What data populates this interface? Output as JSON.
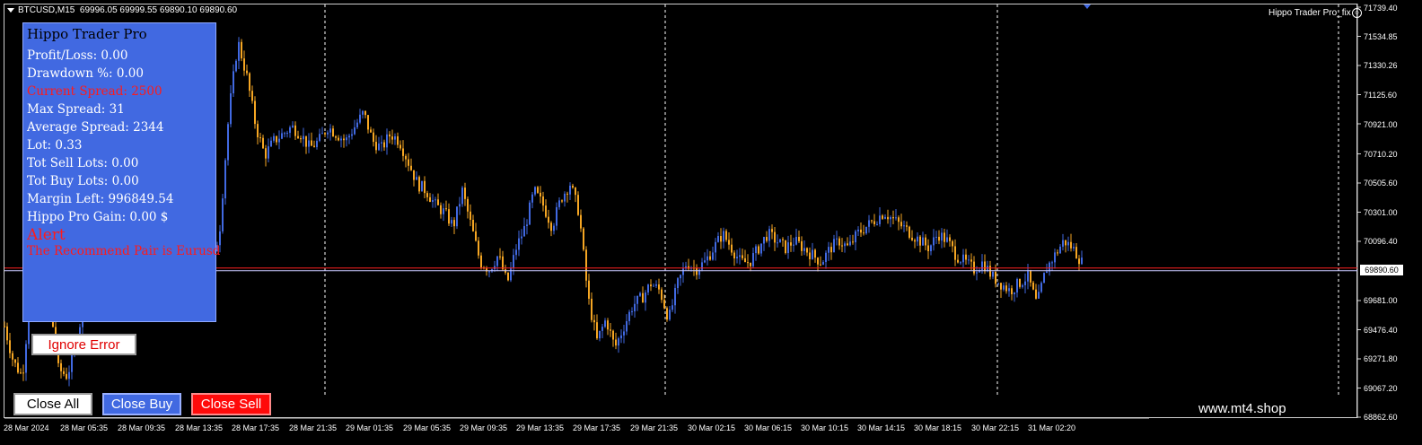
{
  "window": {
    "symbol": "BTCUSD,M15",
    "ohlc": "69996.05 69999.55 69890.10 69890.60",
    "ea_label": "Hippo Trader Pro_fix",
    "smile_icon": "smiley-icon",
    "watermark": "www.mt4.shop"
  },
  "panel": {
    "title": "Hippo Trader Pro",
    "rows": [
      {
        "text": "Profit/Loss: 0.00",
        "color": "#ffffff"
      },
      {
        "text": "Drawdown %: 0.00",
        "color": "#ffffff"
      },
      {
        "text": "Current Spread: 2500",
        "color": "#ff1a1a"
      },
      {
        "text": "Max Spread: 31",
        "color": "#ffffff"
      },
      {
        "text": "Average Spread: 2344",
        "color": "#ffffff"
      },
      {
        "text": "Lot: 0.33",
        "color": "#ffffff"
      },
      {
        "text": "Tot Sell Lots: 0.00",
        "color": "#ffffff"
      },
      {
        "text": "Tot Buy Lots: 0.00",
        "color": "#ffffff"
      },
      {
        "text": "Margin Left: 996849.54",
        "color": "#ffffff"
      },
      {
        "text": "Hippo Pro Gain: 0.00 $",
        "color": "#ffffff"
      }
    ],
    "alert_title": "Alert",
    "alert_message": "The Recommend Pair is Eurusd",
    "bg_color": "#4169e1"
  },
  "buttons": {
    "ignore_error": "Ignore Error",
    "close_all": "Close All",
    "close_buy": "Close Buy",
    "close_sell": "Close Sell"
  },
  "price_axis": {
    "labels": [
      "71739.40",
      "71534.85",
      "71330.26",
      "71125.60",
      "70921.00",
      "70710.20",
      "70505.60",
      "70301.00",
      "70096.40",
      "69681.00",
      "69476.40",
      "69271.80",
      "69067.20",
      "68862.60"
    ],
    "current_price": "69890.60"
  },
  "time_axis": {
    "labels": [
      "28 Mar 2024",
      "28 Mar 05:35",
      "28 Mar 09:35",
      "28 Mar 13:35",
      "28 Mar 17:35",
      "28 Mar 21:35",
      "29 Mar 01:35",
      "29 Mar 05:35",
      "29 Mar 09:35",
      "29 Mar 13:35",
      "29 Mar 17:35",
      "29 Mar 21:35",
      "30 Mar 02:15",
      "30 Mar 06:15",
      "30 Mar 10:15",
      "30 Mar 14:15",
      "30 Mar 18:15",
      "30 Mar 22:15",
      "31 Mar 02:20"
    ]
  },
  "chart_data": {
    "type": "candlestick",
    "symbol": "BTCUSD",
    "timeframe": "M15",
    "ylim": [
      68862.6,
      71739.4
    ],
    "current_price": 69890.6,
    "bull_color": "#4169e1",
    "bear_color": "#f5a623",
    "close_path": [
      [
        0,
        69500
      ],
      [
        10,
        69250
      ],
      [
        20,
        69150
      ],
      [
        30,
        69800
      ],
      [
        40,
        70400
      ],
      [
        50,
        69700
      ],
      [
        60,
        69200
      ],
      [
        70,
        69150
      ],
      [
        80,
        69400
      ],
      [
        90,
        69700
      ],
      [
        100,
        69800
      ],
      [
        110,
        70300
      ],
      [
        120,
        70600
      ],
      [
        130,
        70850
      ],
      [
        140,
        70900
      ],
      [
        150,
        70800
      ],
      [
        160,
        70900
      ],
      [
        170,
        70600
      ],
      [
        180,
        70650
      ],
      [
        190,
        70700
      ],
      [
        200,
        70400
      ],
      [
        210,
        69900
      ],
      [
        220,
        69700
      ],
      [
        230,
        69850
      ],
      [
        240,
        70200
      ],
      [
        250,
        71000
      ],
      [
        260,
        71500
      ],
      [
        270,
        71250
      ],
      [
        280,
        70900
      ],
      [
        290,
        70700
      ],
      [
        300,
        70800
      ],
      [
        310,
        70850
      ],
      [
        320,
        70900
      ],
      [
        330,
        70850
      ],
      [
        340,
        70750
      ],
      [
        350,
        70800
      ],
      [
        360,
        70900
      ],
      [
        370,
        70850
      ],
      [
        380,
        70800
      ],
      [
        390,
        70900
      ],
      [
        400,
        71000
      ],
      [
        410,
        70800
      ],
      [
        420,
        70750
      ],
      [
        430,
        70850
      ],
      [
        440,
        70800
      ],
      [
        450,
        70650
      ],
      [
        460,
        70500
      ],
      [
        470,
        70450
      ],
      [
        480,
        70350
      ],
      [
        490,
        70300
      ],
      [
        500,
        70200
      ],
      [
        510,
        70450
      ],
      [
        520,
        70200
      ],
      [
        530,
        69950
      ],
      [
        540,
        69900
      ],
      [
        550,
        70000
      ],
      [
        560,
        69800
      ],
      [
        570,
        70050
      ],
      [
        580,
        70200
      ],
      [
        590,
        70450
      ],
      [
        600,
        70350
      ],
      [
        610,
        70200
      ],
      [
        620,
        70400
      ],
      [
        630,
        70500
      ],
      [
        640,
        70300
      ],
      [
        650,
        69700
      ],
      [
        660,
        69400
      ],
      [
        670,
        69550
      ],
      [
        680,
        69350
      ],
      [
        690,
        69500
      ],
      [
        700,
        69650
      ],
      [
        710,
        69700
      ],
      [
        720,
        69800
      ],
      [
        730,
        69750
      ],
      [
        740,
        69550
      ],
      [
        750,
        69800
      ],
      [
        760,
        69950
      ],
      [
        770,
        69900
      ],
      [
        780,
        69950
      ],
      [
        790,
        70050
      ],
      [
        800,
        70150
      ],
      [
        810,
        70050
      ],
      [
        820,
        69950
      ],
      [
        830,
        69950
      ],
      [
        840,
        70050
      ],
      [
        850,
        70150
      ],
      [
        860,
        70100
      ],
      [
        870,
        70050
      ],
      [
        880,
        70100
      ],
      [
        890,
        70050
      ],
      [
        900,
        70000
      ],
      [
        910,
        69950
      ],
      [
        920,
        70050
      ],
      [
        930,
        70100
      ],
      [
        940,
        70050
      ],
      [
        950,
        70150
      ],
      [
        960,
        70200
      ],
      [
        970,
        70250
      ],
      [
        980,
        70300
      ],
      [
        990,
        70250
      ],
      [
        1000,
        70200
      ],
      [
        1010,
        70150
      ],
      [
        1020,
        70100
      ],
      [
        1030,
        70050
      ],
      [
        1040,
        70150
      ],
      [
        1050,
        70100
      ],
      [
        1060,
        70000
      ],
      [
        1070,
        69950
      ],
      [
        1080,
        69900
      ],
      [
        1090,
        69950
      ],
      [
        1100,
        69850
      ],
      [
        1110,
        69800
      ],
      [
        1120,
        69750
      ],
      [
        1130,
        69800
      ],
      [
        1140,
        69850
      ],
      [
        1150,
        69650
      ],
      [
        1160,
        69900
      ],
      [
        1170,
        70000
      ],
      [
        1180,
        70100
      ],
      [
        1190,
        70050
      ],
      [
        1200,
        69950
      ],
      [
        1207,
        69890
      ]
    ]
  }
}
